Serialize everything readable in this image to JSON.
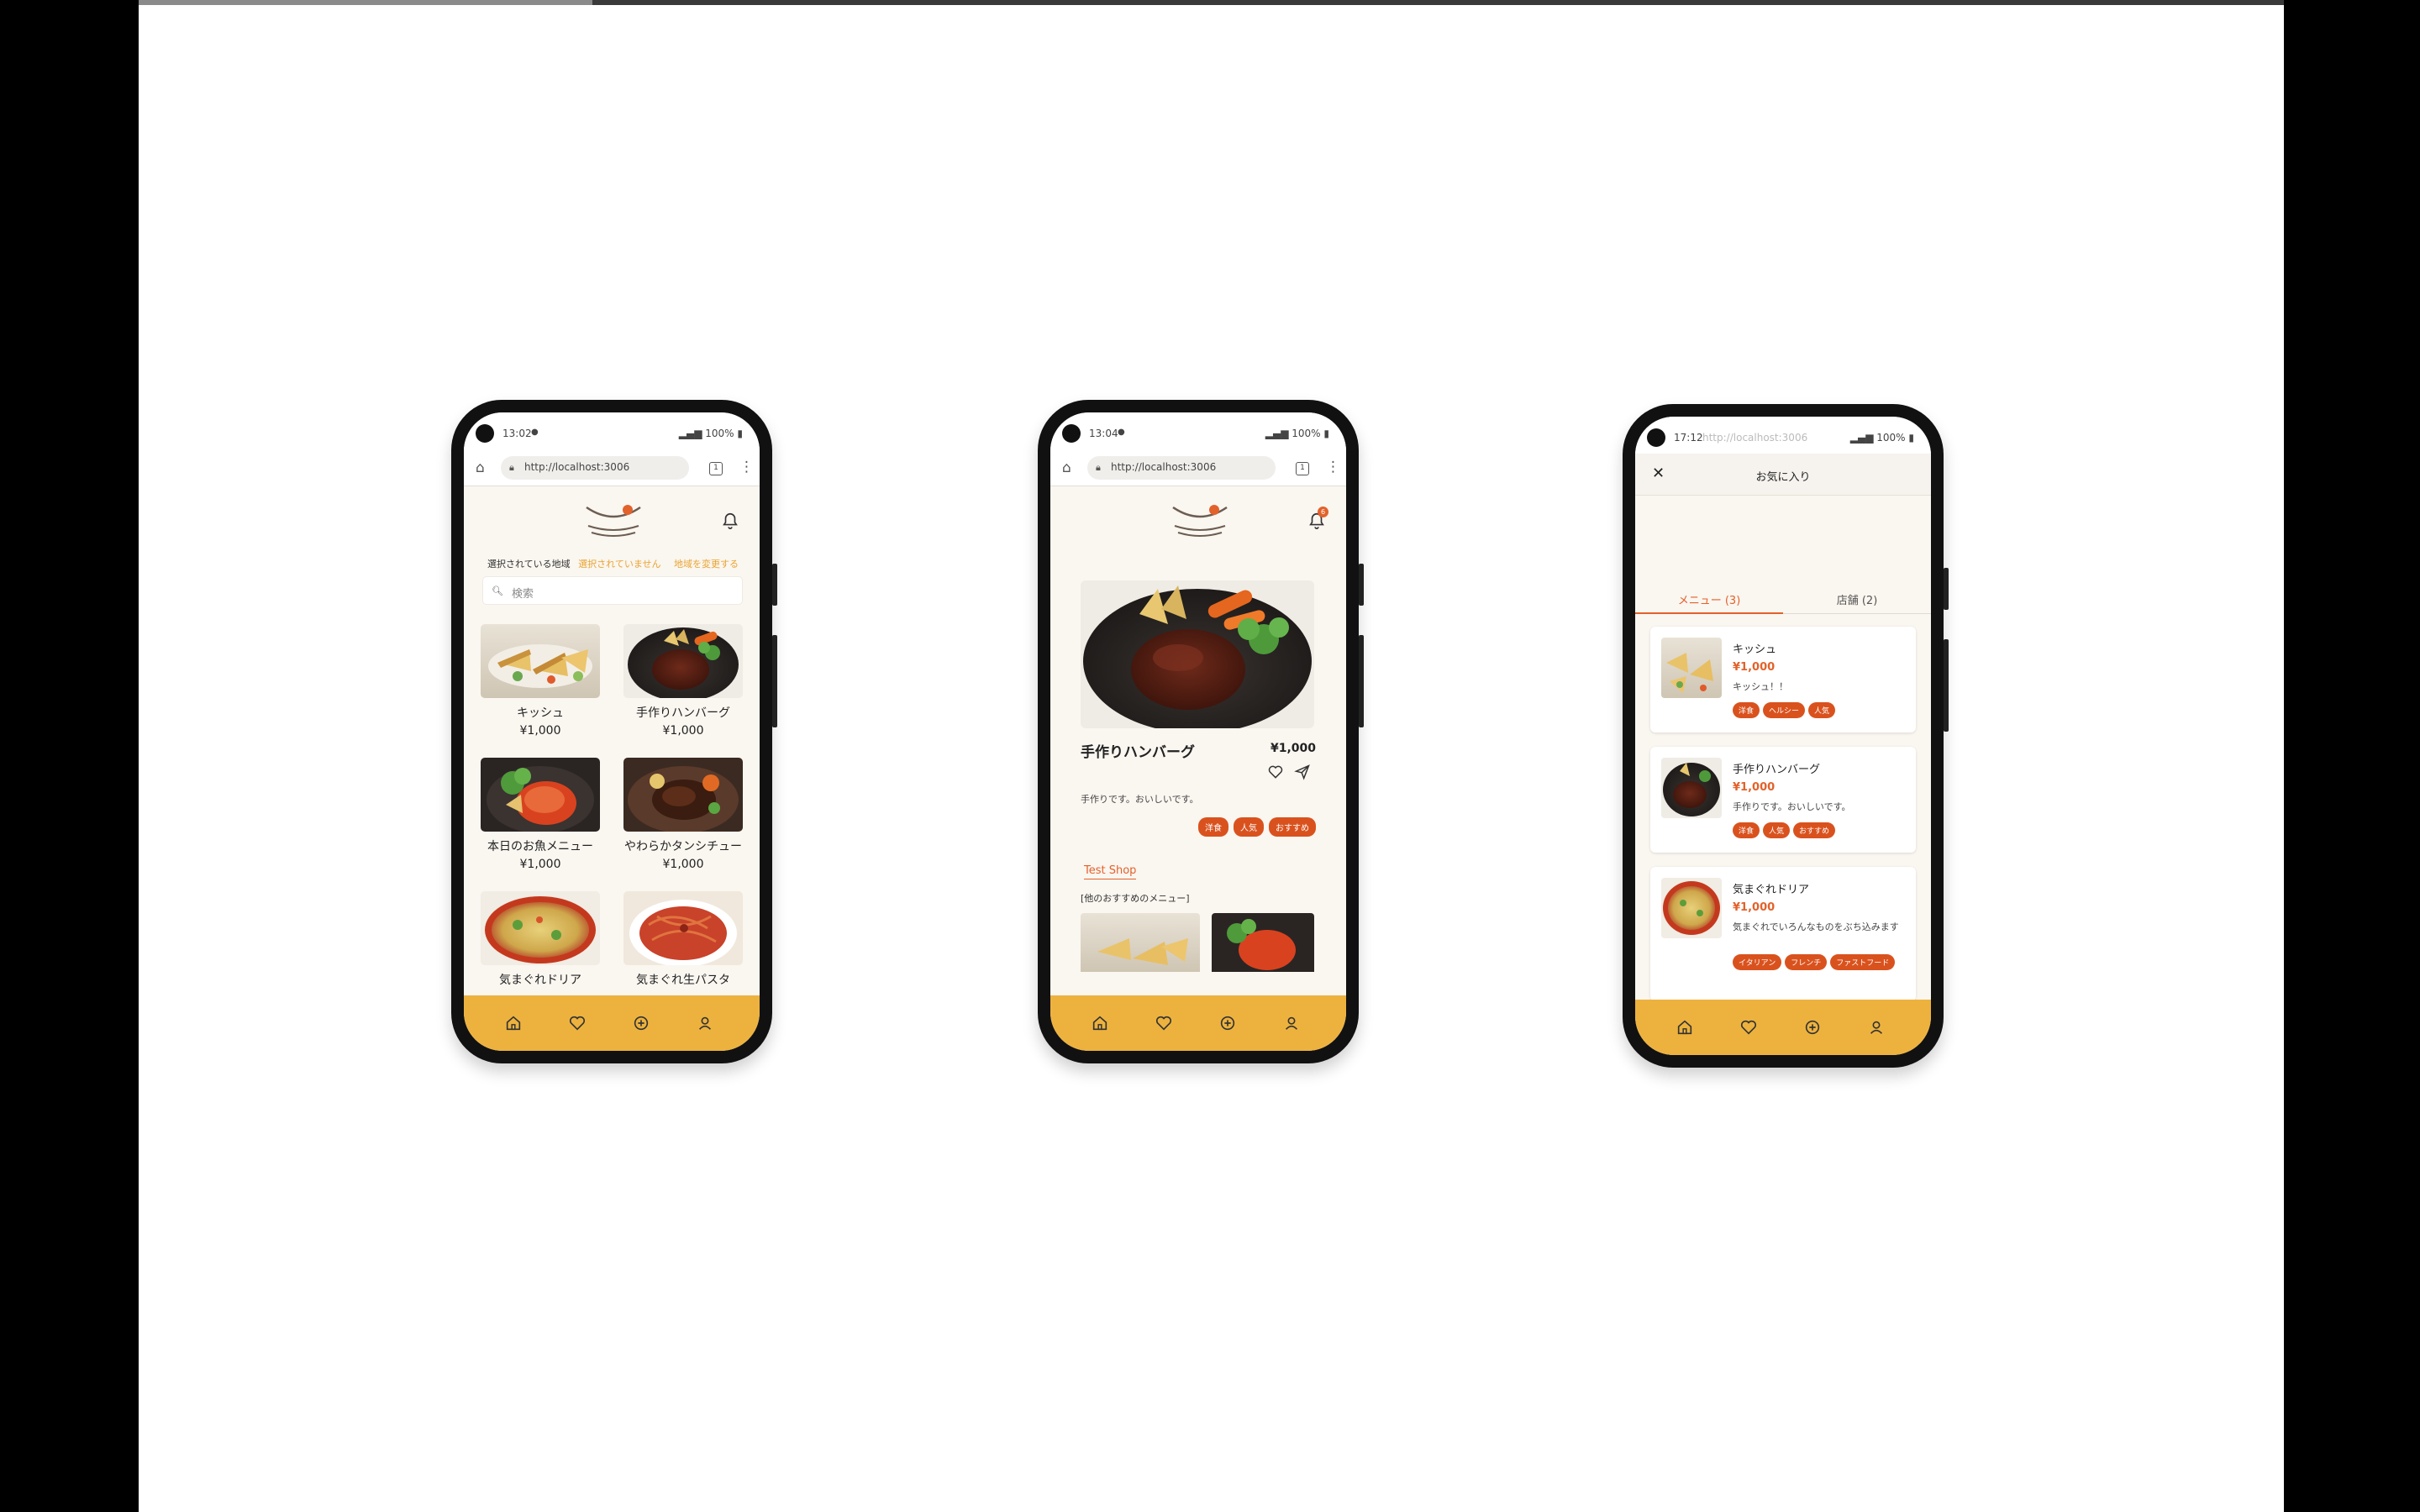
{
  "phone1": {
    "status": {
      "time": "13:02",
      "battery": "100%"
    },
    "browser": {
      "url": "http://localhost:3006",
      "tab_count": "1"
    },
    "region": {
      "label": "選択されている地域",
      "value": "選択されていません",
      "change_link": "地域を変更する"
    },
    "search": {
      "placeholder": "検索"
    },
    "items": [
      {
        "name": "キッシュ",
        "price": "¥1,000"
      },
      {
        "name": "手作りハンバーグ",
        "price": "¥1,000"
      },
      {
        "name": "本日のお魚メニュー",
        "price": "¥1,000"
      },
      {
        "name": "やわらかタンシチュー",
        "price": "¥1,000"
      },
      {
        "name": "気まぐれドリア",
        "price": ""
      },
      {
        "name": "気まぐれ生パスタ",
        "price": ""
      }
    ]
  },
  "phone2": {
    "status": {
      "time": "13:04",
      "battery": "100%"
    },
    "browser": {
      "url": "http://localhost:3006",
      "tab_count": "1"
    },
    "notification_count": "6",
    "detail": {
      "title": "手作りハンバーグ",
      "price": "¥1,000",
      "description": "手作りです。おいしいです。",
      "tags": [
        "洋食",
        "人気",
        "おすすめ"
      ],
      "shop_name": "Test Shop",
      "other_menu_heading": "[他のおすすめのメニュー]"
    }
  },
  "phone3": {
    "status": {
      "time": "17:12",
      "battery": "100%",
      "ghost_url": "http://localhost:3006"
    },
    "header_title": "お気に入り",
    "tabs": {
      "menu": "メニュー (3)",
      "shops": "店舗 (2)"
    },
    "favorites": [
      {
        "name": "キッシュ",
        "price": "¥1,000",
        "description": "キッシュ！！",
        "tags": [
          "洋食",
          "ヘルシー",
          "人気"
        ]
      },
      {
        "name": "手作りハンバーグ",
        "price": "¥1,000",
        "description": "手作りです。おいしいです。",
        "tags": [
          "洋食",
          "人気",
          "おすすめ"
        ]
      },
      {
        "name": "気まぐれドリア",
        "price": "¥1,000",
        "description": "気まぐれでいろんなものをぶち込みます",
        "tags": [
          "イタリアン",
          "フレンチ",
          "ファストフード"
        ]
      }
    ]
  },
  "colors": {
    "accent": "#e2622b",
    "navbar": "#edb23e",
    "tag": "#d9521e",
    "region_link": "#e9a431",
    "background": "#faf6f0"
  },
  "icons": {
    "nav": [
      "home-icon",
      "heart-icon",
      "plus-circle-icon",
      "user-icon"
    ]
  }
}
